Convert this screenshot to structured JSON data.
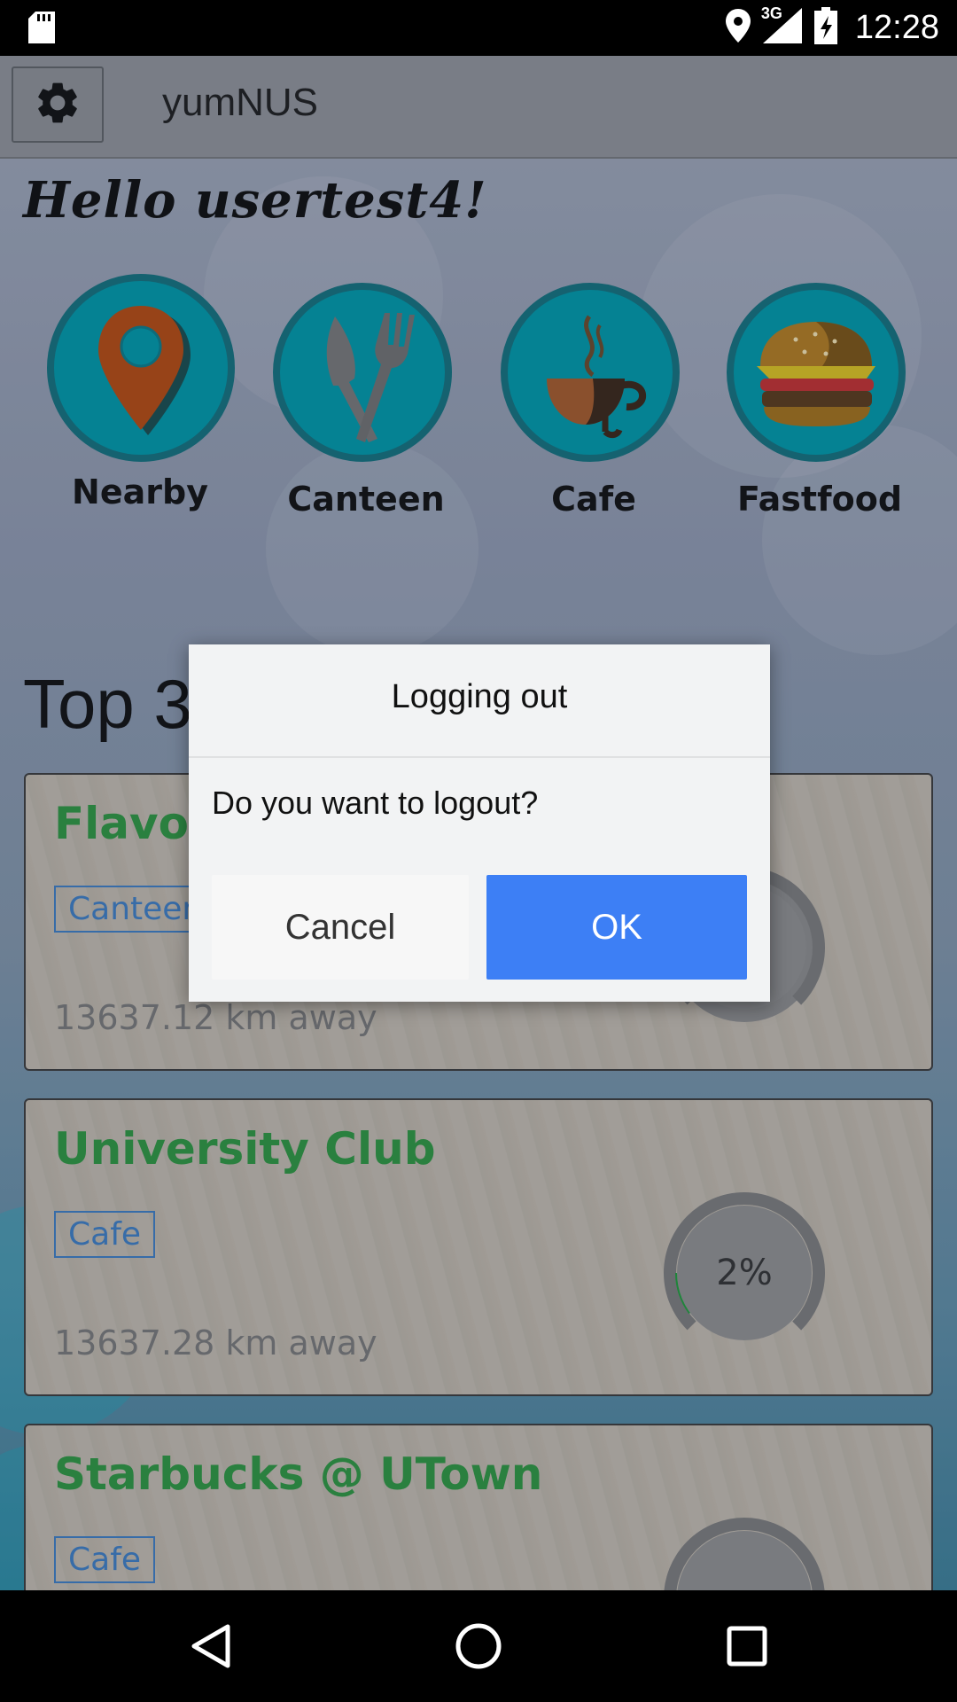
{
  "status_bar": {
    "network": "3G",
    "time": "12:28"
  },
  "app_bar": {
    "title": "yumNUS",
    "settings_icon": "gear-icon"
  },
  "greeting": "Hello usertest4!",
  "categories": [
    {
      "label": "Nearby",
      "icon": "location-pin-icon"
    },
    {
      "label": "Canteen",
      "icon": "knife-fork-icon"
    },
    {
      "label": "Cafe",
      "icon": "coffee-cup-icon"
    },
    {
      "label": "Fastfood",
      "icon": "burger-icon"
    }
  ],
  "section_title": "Top 3 Picks",
  "picks": [
    {
      "name": "Flavours @ UTown",
      "tag": "Canteen",
      "distance": "13637.12 km away",
      "percent": ""
    },
    {
      "name": "University Club",
      "tag": "Cafe",
      "distance": "13637.28 km away",
      "percent": "2%"
    },
    {
      "name": "Starbucks @ UTown",
      "tag": "Cafe",
      "distance": "",
      "percent": ""
    }
  ],
  "dialog": {
    "title": "Logging out",
    "message": "Do you want to logout?",
    "cancel_label": "Cancel",
    "ok_label": "OK"
  },
  "colors": {
    "accent_teal": "#0097a7",
    "ok_blue": "#3d7ff5",
    "pick_name_green": "#2e9440",
    "tag_blue": "#3d7cc0"
  }
}
